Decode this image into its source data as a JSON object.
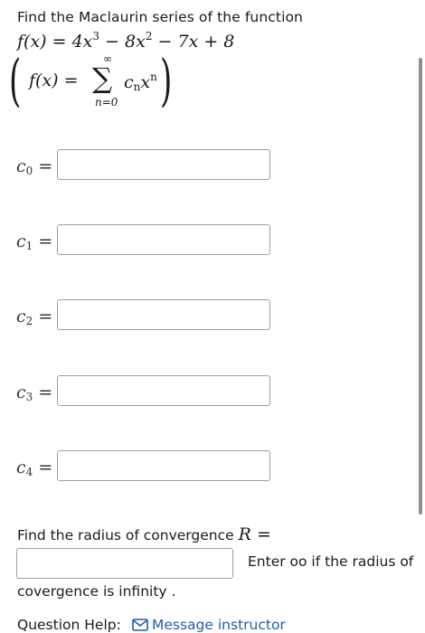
{
  "question": {
    "prompt": "Find the Maclaurin series of the function",
    "function_lhs": "f(x) = ",
    "function_rhs_terms": [
      "4x",
      "3",
      " − 8x",
      "2",
      " − 7x + 8"
    ],
    "series_lhs": "f(x) = ",
    "series_sum_upper": "∞",
    "series_sum_lower": "n=0",
    "series_term_c": "c",
    "series_term_sub": "n",
    "series_term_x": "x",
    "series_term_sup": "n"
  },
  "coefficients": [
    {
      "label": "c",
      "index": "0",
      "value": ""
    },
    {
      "label": "c",
      "index": "1",
      "value": ""
    },
    {
      "label": "c",
      "index": "2",
      "value": ""
    },
    {
      "label": "c",
      "index": "3",
      "value": ""
    },
    {
      "label": "c",
      "index": "4",
      "value": ""
    }
  ],
  "equals_sign": "=",
  "radius": {
    "prompt": "Find the radius of convergence ",
    "symbol": "R",
    "equals": " =",
    "value": "",
    "hint_line1": "Enter oo if the radius of",
    "hint_line2": "covergence is infinity ."
  },
  "help": {
    "label": "Question Help:",
    "link_text": "Message instructor",
    "icon": "envelope-icon"
  }
}
